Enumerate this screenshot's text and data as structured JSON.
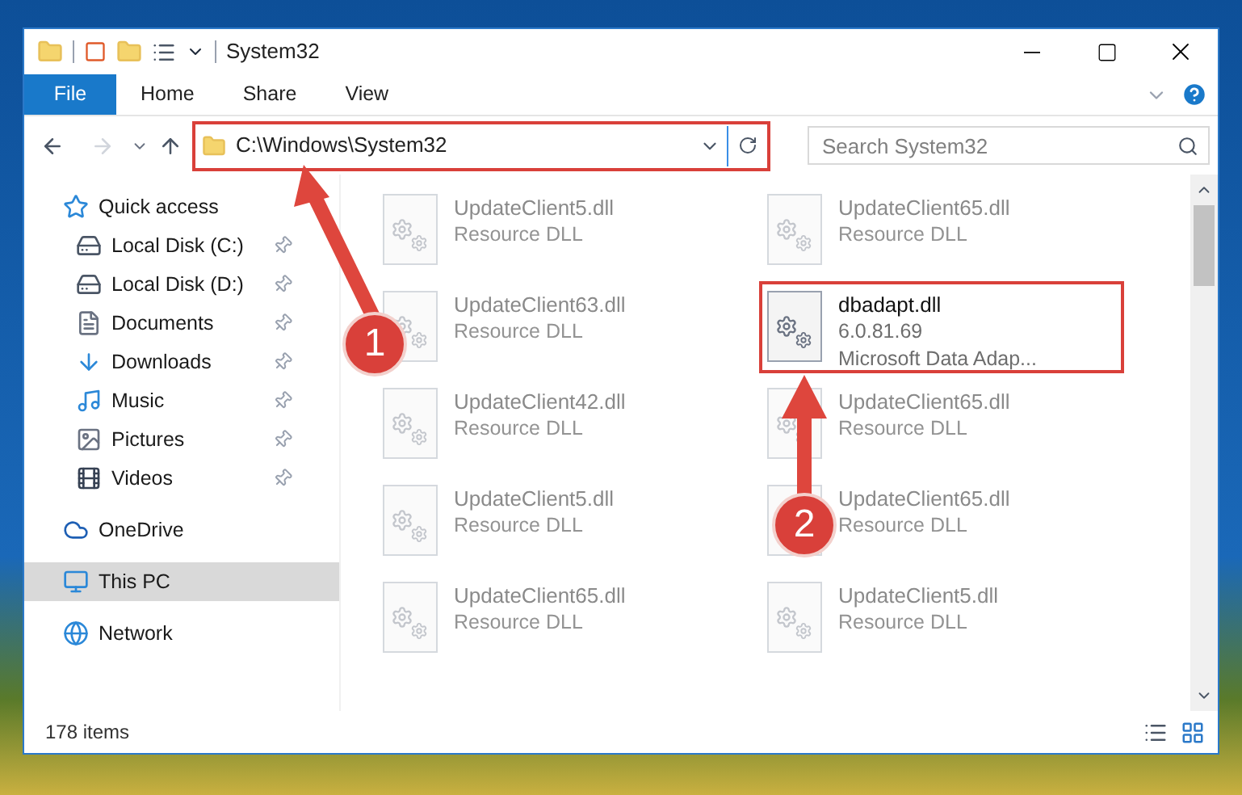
{
  "window": {
    "title": "System32"
  },
  "ribbon": {
    "tabs": [
      {
        "label": "File",
        "kind": "file"
      },
      {
        "label": "Home",
        "kind": "tab"
      },
      {
        "label": "Share",
        "kind": "tab"
      },
      {
        "label": "View",
        "kind": "tab"
      }
    ]
  },
  "address_bar": {
    "path": "C:\\Windows\\System32",
    "highlighted": true
  },
  "search": {
    "placeholder": "Search System32"
  },
  "sidebar": {
    "items": [
      {
        "label": "Quick access",
        "kind": "star",
        "selected": false,
        "children": [
          {
            "label": "Local Disk (C:)",
            "kind": "disk",
            "pinned": true,
            "selected": false
          },
          {
            "label": "Local Disk (D:)",
            "kind": "disk",
            "pinned": true,
            "selected": false
          },
          {
            "label": "Documents",
            "kind": "documents",
            "pinned": true,
            "selected": false
          },
          {
            "label": "Downloads",
            "kind": "downloads",
            "pinned": true,
            "selected": false
          },
          {
            "label": "Music",
            "kind": "music",
            "pinned": true,
            "selected": false
          },
          {
            "label": "Pictures",
            "kind": "pictures",
            "pinned": true,
            "selected": false
          },
          {
            "label": "Videos",
            "kind": "videos",
            "pinned": true,
            "selected": false
          }
        ]
      },
      {
        "label": "OneDrive",
        "kind": "cloud",
        "selected": false
      },
      {
        "label": "This PC",
        "kind": "pc",
        "selected": true
      },
      {
        "label": "Network",
        "kind": "network",
        "selected": false
      }
    ]
  },
  "files": [
    {
      "name": "UpdateClient5.dll",
      "details": [
        "Resource DLL"
      ],
      "faded": true,
      "highlighted": false
    },
    {
      "name": "UpdateClient65.dll",
      "details": [
        "Resource DLL"
      ],
      "faded": true,
      "highlighted": false
    },
    {
      "name": "UpdateClient63.dll",
      "details": [
        "Resource DLL"
      ],
      "faded": true,
      "highlighted": false
    },
    {
      "name": "dbadapt.dll",
      "details": [
        "6.0.81.69",
        "Microsoft Data Adap..."
      ],
      "faded": false,
      "highlighted": true
    },
    {
      "name": "UpdateClient42.dll",
      "details": [
        "Resource DLL"
      ],
      "faded": true,
      "highlighted": false
    },
    {
      "name": "UpdateClient65.dll",
      "details": [
        "Resource DLL"
      ],
      "faded": true,
      "highlighted": false
    },
    {
      "name": "UpdateClient5.dll",
      "details": [
        "Resource DLL"
      ],
      "faded": true,
      "highlighted": false
    },
    {
      "name": "UpdateClient65.dll",
      "details": [
        "Resource DLL"
      ],
      "faded": true,
      "highlighted": false
    },
    {
      "name": "UpdateClient65.dll",
      "details": [
        "Resource DLL"
      ],
      "faded": true,
      "highlighted": false
    },
    {
      "name": "UpdateClient5.dll",
      "details": [
        "Resource DLL"
      ],
      "faded": true,
      "highlighted": false
    }
  ],
  "status_bar": {
    "item_count": "178 items"
  },
  "annotations": [
    {
      "label": "1"
    },
    {
      "label": "2"
    }
  ]
}
